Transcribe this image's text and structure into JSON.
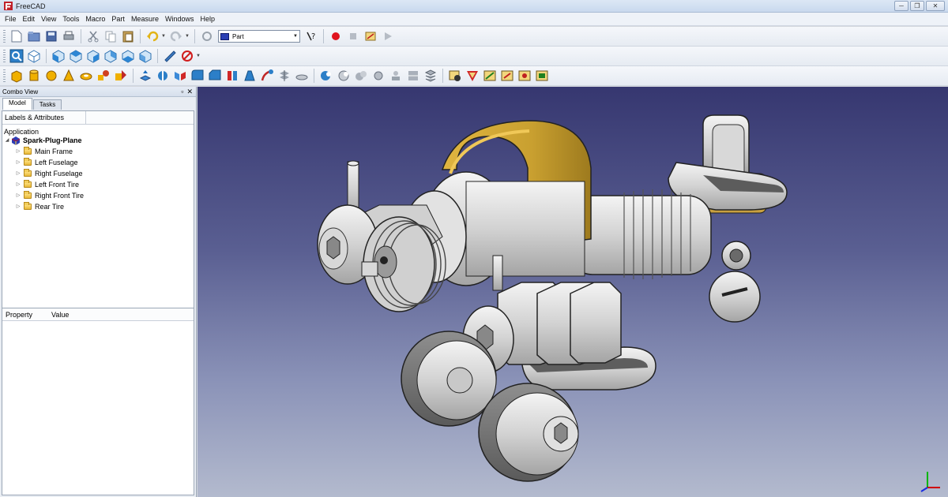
{
  "window": {
    "title": "FreeCAD"
  },
  "menu": [
    "File",
    "Edit",
    "View",
    "Tools",
    "Macro",
    "Part",
    "Measure",
    "Windows",
    "Help"
  ],
  "toolbar": {
    "workbench": "Part"
  },
  "combo_view": {
    "title": "Combo View",
    "tabs": [
      "Model",
      "Tasks"
    ],
    "tree_header": "Labels & Attributes",
    "section": "Application",
    "document": "Spark-Plug-Plane",
    "items": [
      "Main Frame",
      "Left Fuselage",
      "Right Fuselage",
      "Left Front Tire",
      "Right Front Tire",
      "Rear Tire"
    ]
  },
  "property_view": {
    "columns": [
      "Property",
      "Value"
    ]
  },
  "colors": {
    "part_gray": "#d6d6d6",
    "accent_gold": "#c9a030",
    "viewport_top": "#363770",
    "viewport_bottom": "#b3bace"
  }
}
